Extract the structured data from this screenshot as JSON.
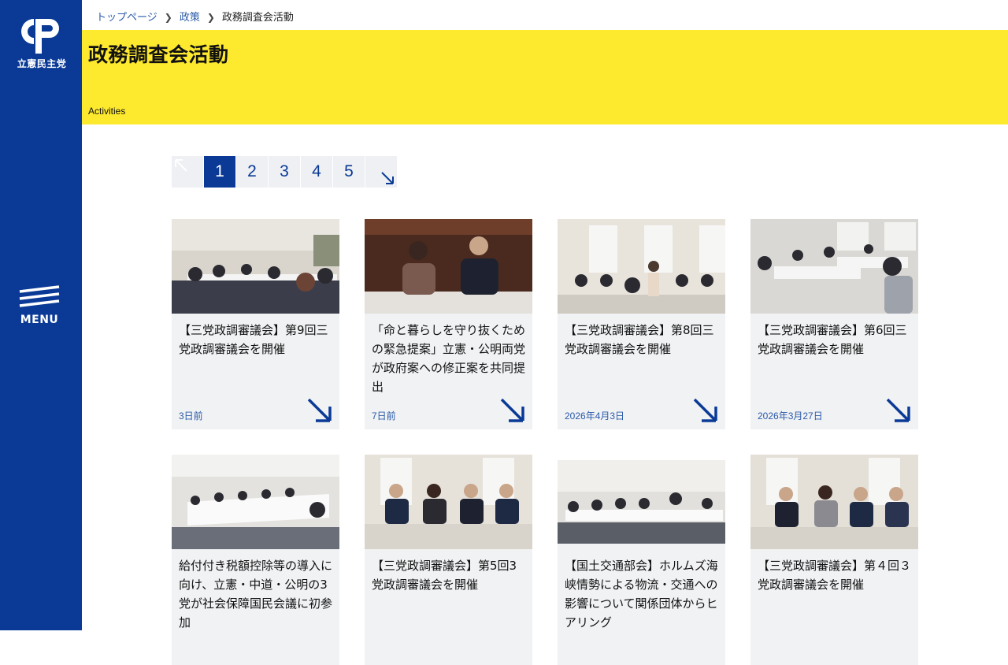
{
  "brand": {
    "logo_mark": "CDP",
    "logo_text": "立憲民主党"
  },
  "menu": {
    "label": "MENU"
  },
  "breadcrumb": {
    "home": "トップページ",
    "section": "政策",
    "current": "政務調査会活動"
  },
  "banner": {
    "title": "政務調査会活動",
    "subtitle": "Activities"
  },
  "pagination": {
    "pages": [
      "1",
      "2",
      "3",
      "4",
      "5"
    ],
    "current": "1"
  },
  "cards": [
    {
      "title": "【三党政調審議会】第9回三党政調審議会を開催",
      "date": "3日前"
    },
    {
      "title": "「命と暮らしを守り抜くための緊急提案」立憲・公明両党が政府案への修正案を共同提出",
      "date": "7日前"
    },
    {
      "title": "【三党政調審議会】第8回三党政調審議会を開催",
      "date": "2026年4月3日"
    },
    {
      "title": "【三党政調審議会】第6回三党政調審議会を開催",
      "date": "2026年3月27日"
    },
    {
      "title": "給付付き税額控除等の導入に向け、立憲・中道・公明の3党が社会保障国民会議に初参加",
      "date": ""
    },
    {
      "title": "【三党政調審議会】第5回3党政調審議会を開催",
      "date": ""
    },
    {
      "title": "【国土交通部会】ホルムズ海峡情勢による物流・交通への影響について関係団体からヒアリング",
      "date": ""
    },
    {
      "title": "【三党政調審議会】第４回３党政調審議会を開催",
      "date": ""
    }
  ],
  "colors": {
    "brand_blue": "#0a3a96",
    "banner_yellow": "#fde92e",
    "card_bg": "#f1f2f4",
    "link_blue": "#2a5aa8"
  },
  "icons": {
    "menu": "hamburger-icon",
    "prev": "arrow-up-left-icon",
    "next": "arrow-down-right-icon",
    "card_arrow": "arrow-down-right-icon"
  }
}
